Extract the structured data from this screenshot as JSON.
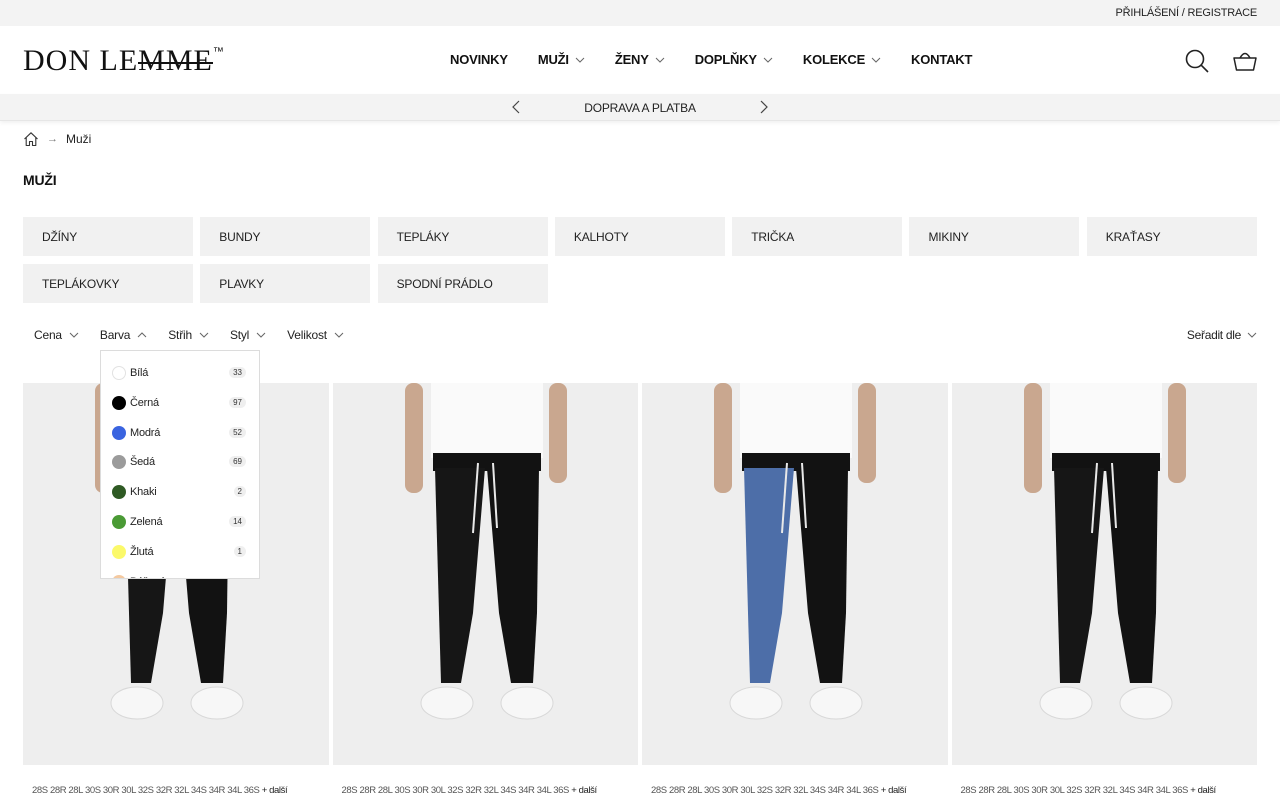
{
  "topbar": {
    "login": "PŘIHLÁŠENÍ",
    "separator": "/",
    "register": "REGISTRACE"
  },
  "logo": {
    "part1": "DON LE",
    "part2": "MME",
    "tm": "™"
  },
  "nav": [
    {
      "label": "NOVINKY",
      "dropdown": false
    },
    {
      "label": "MUŽI",
      "dropdown": true
    },
    {
      "label": "ŽENY",
      "dropdown": true
    },
    {
      "label": "DOPLŇKY",
      "dropdown": true
    },
    {
      "label": "KOLEKCE",
      "dropdown": true
    },
    {
      "label": "KONTAKT",
      "dropdown": false
    }
  ],
  "header_icons": [
    "search-icon",
    "basket-icon"
  ],
  "promo": {
    "text": "DOPRAVA A PLATBA"
  },
  "breadcrumb": {
    "current": "Muži",
    "arrow": "→"
  },
  "page_title": "MUŽI",
  "categories": [
    "DŽÍNY",
    "BUNDY",
    "TEPLÁKY",
    "KALHOTY",
    "TRIČKA",
    "MIKINY",
    "KRAŤASY",
    "TEPLÁKOVKY",
    "PLAVKY",
    "SPODNÍ PRÁDLO"
  ],
  "filters": [
    {
      "label": "Cena",
      "open": false
    },
    {
      "label": "Barva",
      "open": true
    },
    {
      "label": "Střih",
      "open": false
    },
    {
      "label": "Styl",
      "open": false
    },
    {
      "label": "Velikost",
      "open": false
    }
  ],
  "sort": {
    "label": "Seřadit dle"
  },
  "color_filter": {
    "options": [
      {
        "name": "Bílá",
        "count": "33",
        "color": "#ffffff"
      },
      {
        "name": "Černá",
        "count": "97",
        "color": "#000000"
      },
      {
        "name": "Modrá",
        "count": "52",
        "color": "#3a64e0"
      },
      {
        "name": "Šedá",
        "count": "69",
        "color": "#9b9b9b"
      },
      {
        "name": "Khaki",
        "count": "2",
        "color": "#2f5a24"
      },
      {
        "name": "Zelená",
        "count": "14",
        "color": "#4a9a35"
      },
      {
        "name": "Žlutá",
        "count": "1",
        "color": "#fbf96a"
      },
      {
        "name": "Béžová",
        "count": "",
        "color": "#f4c9a0"
      }
    ]
  },
  "products": [
    {
      "sizes": "28S 28R 28L 30S 30R 30L 32S 32R 32L 34S 34R 34L 36S",
      "more": "+ další",
      "denim": "black"
    },
    {
      "sizes": "28S 28R 28L 30S 30R 30L 32S 32R 32L 34S 34R 34L 36S",
      "more": "+ další",
      "denim": "black"
    },
    {
      "sizes": "28S 28R 28L 30S 30R 30L 32S 32R 32L 34S 34R 34L 36S",
      "more": "+ další",
      "denim": "blue-black"
    },
    {
      "sizes": "28S 28R 28L 30S 30R 30L 32S 32R 32L 34S 34R 34L 36S",
      "more": "+ další",
      "denim": "black"
    }
  ]
}
